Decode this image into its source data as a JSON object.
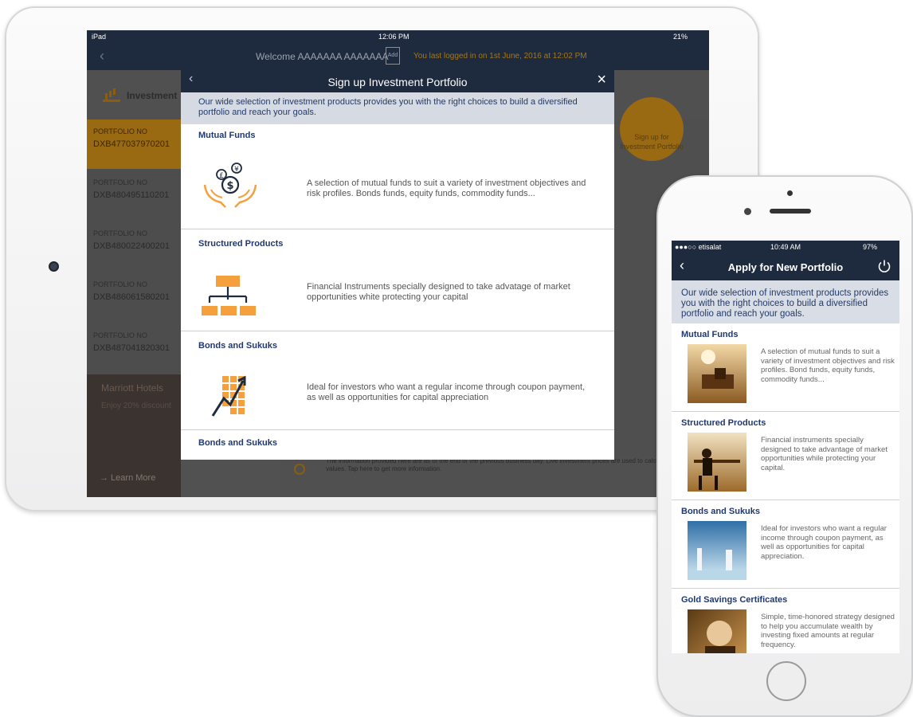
{
  "ipad": {
    "status": {
      "device": "iPad",
      "time": "12:06 PM",
      "battery": "21%"
    },
    "nav": {
      "welcome": "Welcome AAAAAAA AAAAAAA",
      "add": "Add",
      "last_login": "You last logged in on 1st June, 2016 at 12:02 PM"
    },
    "header": {
      "title": "Investment"
    },
    "portfolios": [
      {
        "label": "PORTFOLIO NO",
        "number": "DXB477037970201"
      },
      {
        "label": "PORTFOLIO NO",
        "number": "DXB480495110201"
      },
      {
        "label": "PORTFOLIO NO",
        "number": "DXB480022400201"
      },
      {
        "label": "PORTFOLIO NO",
        "number": "DXB486061580201"
      },
      {
        "label": "PORTFOLIO NO",
        "number": "DXB487041820301"
      }
    ],
    "promo": {
      "title": "Marriott Hotels",
      "subtitle": "Enjoy 20% discount",
      "cta": "→ Learn More"
    },
    "signup_circle": "Sign up for Investment Portfolio",
    "footer_note": "The information provided here are as of the end of the previous business day. Live investment prices are used to calculate the market values. Tap here to get more information.",
    "modal": {
      "title": "Sign up Investment Portfolio",
      "intro": "Our wide selection of investment products provides you with the right choices to build a diversified portfolio and reach your goals.",
      "sections": [
        {
          "title": "Mutual Funds",
          "desc": "A selection of mutual funds to suit a variety of investment objectives and risk profiles. Bonds funds, equity funds, commodity funds...",
          "icon": "money-hands-icon"
        },
        {
          "title": "Structured Products",
          "desc": "Financial Instruments specially designed to take advatage of market opportunities white protecting your capital",
          "icon": "org-chart-icon"
        },
        {
          "title": "Bonds and Sukuks",
          "desc": "Ideal for investors who want a regular income through coupon payment, as well as opportunities for capital appreciation",
          "icon": "growth-chart-icon"
        },
        {
          "title": "Bonds and Sukuks"
        }
      ]
    }
  },
  "iphone": {
    "status": {
      "carrier": "●●●○○ etisalat",
      "time": "10:49 AM",
      "battery": "97%"
    },
    "title": "Apply for New Portfolio",
    "intro": "Our wide selection of investment products provides you with the right choices to build a diversified portfolio and reach your goals.",
    "sections": [
      {
        "title": "Mutual Funds",
        "desc": "A selection of mutual funds to suit a variety of investment objectives and risk profiles. Bond funds, equity funds, commodity funds..."
      },
      {
        "title": "Structured Products",
        "desc": "Financial instruments specially designed to take advantage of market opportunities while protecting your capital."
      },
      {
        "title": "Bonds and Sukuks",
        "desc": "Ideal for investors who want a regular income through coupon payment, as well as opportunities for capital appreciation."
      },
      {
        "title": "Gold Savings Certificates",
        "desc": "Simple, time-honored strategy designed to help you accumulate wealth by investing fixed amounts at regular frequency."
      }
    ]
  },
  "colors": {
    "navy": "#1e2a3e",
    "gold": "#f0a820",
    "link_blue": "#1f3870",
    "icon_orange": "#f5a03c"
  }
}
